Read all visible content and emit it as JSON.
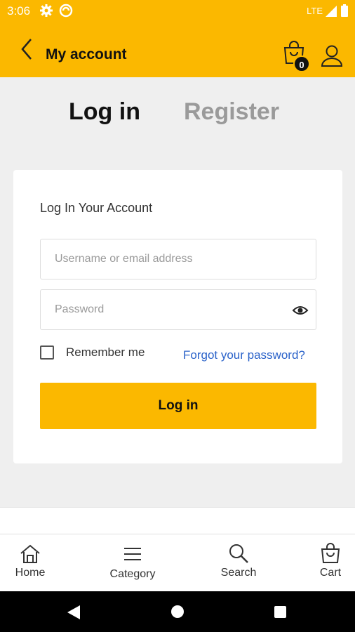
{
  "status_bar": {
    "time": "3:06",
    "network": "LTE",
    "icons": [
      "settings-icon",
      "sync-icon",
      "signal-icon",
      "battery-icon"
    ]
  },
  "header": {
    "title": "My account",
    "cart_count": "0",
    "icons": [
      "back-arrow-icon",
      "shopping-bag-icon",
      "user-icon"
    ]
  },
  "tabs": {
    "login": "Log in",
    "register": "Register"
  },
  "login_form": {
    "title": "Log In Your Account",
    "username_placeholder": "Username or email address",
    "password_placeholder": "Password",
    "remember_label": "Remember me",
    "remember_checked": false,
    "forgot_link": "Forgot your password?",
    "submit_label": "Log in"
  },
  "bottom_nav": {
    "items": [
      {
        "label": "Home",
        "icon": "home-icon"
      },
      {
        "label": "Category",
        "icon": "menu-icon"
      },
      {
        "label": "Search",
        "icon": "search-icon"
      },
      {
        "label": "Cart",
        "icon": "shopping-bag-icon"
      }
    ]
  },
  "colors": {
    "brand": "#fbb800",
    "link": "#2a62c9",
    "background": "#efefef"
  }
}
